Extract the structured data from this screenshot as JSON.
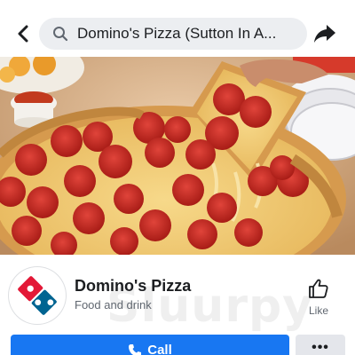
{
  "header": {
    "search_text": "Domino's Pizza (Sutton In A...",
    "icons": [
      "back-arrow-icon",
      "search-icon",
      "share-icon"
    ]
  },
  "cover": {
    "description_icons": [
      "pizza-photo"
    ]
  },
  "page": {
    "name": "Domino's Pizza",
    "category": "Food and drink",
    "like_label": "Like"
  },
  "watermark": {
    "text": "Sluurpy"
  },
  "actions": {
    "call_label": "Call",
    "more_label": "•••"
  },
  "colors": {
    "accent": "#1877f2",
    "domino_red": "#e31837",
    "domino_blue": "#006491"
  }
}
